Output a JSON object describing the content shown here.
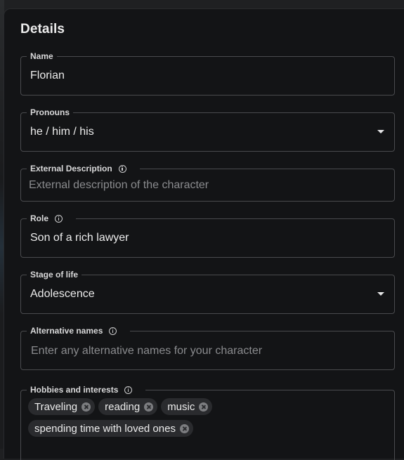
{
  "section_title": "Details",
  "fields": {
    "name": {
      "label": "Name",
      "value": "Florian"
    },
    "pronouns": {
      "label": "Pronouns",
      "value": "he / him / his"
    },
    "external_description": {
      "label": "External Description",
      "placeholder": "External description of the character"
    },
    "role": {
      "label": "Role",
      "value": "Son of a rich lawyer"
    },
    "stage_of_life": {
      "label": "Stage of life",
      "value": "Adolescence"
    },
    "alternative_names": {
      "label": "Alternative names",
      "placeholder": "Enter any alternative names for your character"
    },
    "hobbies": {
      "label": "Hobbies and interests",
      "chips": [
        "Traveling",
        "reading",
        "music",
        "spending time with loved ones"
      ]
    }
  },
  "icons": {
    "info": "info-circle-icon",
    "dropdown": "caret-down-icon",
    "chip_remove": "close-circle-icon"
  },
  "colors": {
    "background": "#131416",
    "border": "#4a4b4e",
    "text": "#ececec",
    "placeholder": "#8a8b8e",
    "chip": "#2a2b2e"
  }
}
